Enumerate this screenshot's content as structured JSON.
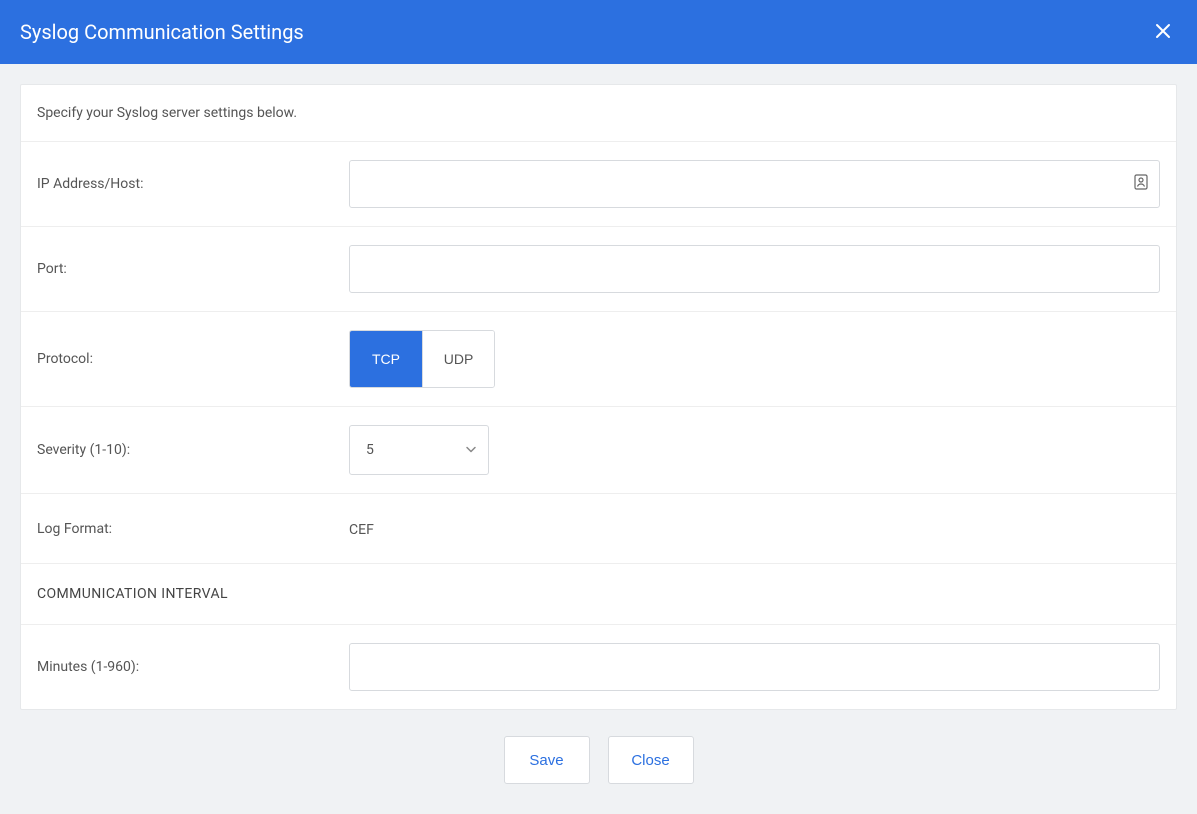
{
  "dialog": {
    "title": "Syslog Communication Settings",
    "close_icon": "close-icon"
  },
  "intro": "Specify your Syslog server settings below.",
  "form": {
    "ip_label": "IP Address/Host:",
    "ip_value": "",
    "port_label": "Port:",
    "port_value": "",
    "protocol_label": "Protocol:",
    "protocol_options": {
      "tcp": "TCP",
      "udp": "UDP"
    },
    "protocol_selected": "tcp",
    "severity_label": "Severity (1-10):",
    "severity_value": "5",
    "logformat_label": "Log Format:",
    "logformat_value": "CEF",
    "section_heading": "COMMUNICATION INTERVAL",
    "minutes_label": "Minutes (1-960):",
    "minutes_value": ""
  },
  "footer": {
    "save_label": "Save",
    "close_label": "Close"
  }
}
